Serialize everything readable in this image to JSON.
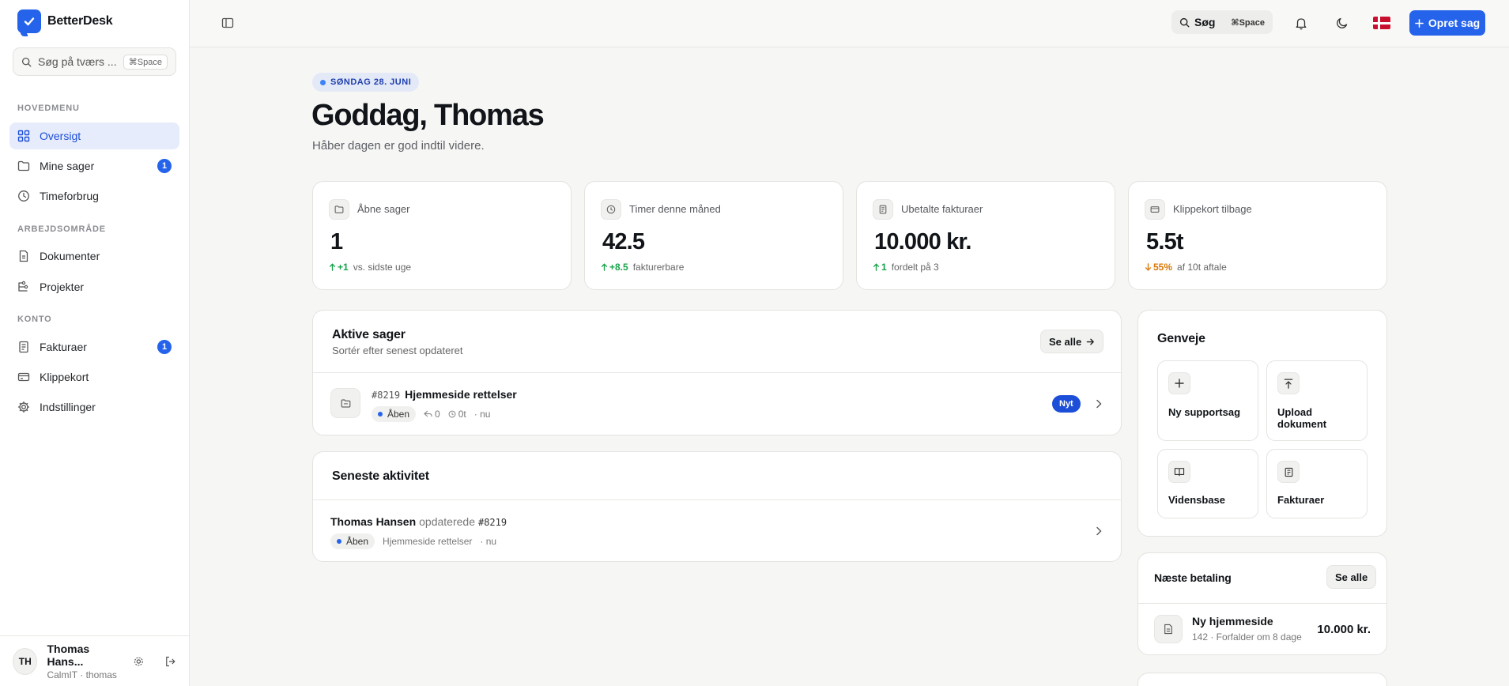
{
  "brand": {
    "name": "BetterDesk",
    "accent": "#2563eb"
  },
  "sidebar": {
    "search": {
      "placeholder": "Søg på tværs ...",
      "shortcut": "⌘Space"
    },
    "sections": {
      "main": "HOVEDMENU",
      "workspace": "ARBEJDSOMRÅDE",
      "account": "KONTO"
    },
    "items": [
      {
        "label": "Oversigt",
        "icon": "grid-icon",
        "active": true
      },
      {
        "label": "Mine sager",
        "icon": "folder-icon",
        "badge": "1"
      },
      {
        "label": "Timeforbrug",
        "icon": "clock-icon"
      },
      {
        "label": "Dokumenter",
        "icon": "document-icon"
      },
      {
        "label": "Projekter",
        "icon": "projects-icon"
      },
      {
        "label": "Fakturaer",
        "icon": "invoice-icon",
        "badge": "1"
      },
      {
        "label": "Klippekort",
        "icon": "card-icon"
      },
      {
        "label": "Indstillinger",
        "icon": "gear-icon"
      }
    ],
    "user": {
      "initials": "TH",
      "name": "Thomas Hans...",
      "sub": "CalmIT · thomas"
    }
  },
  "topbar": {
    "search_label": "Søg",
    "search_shortcut": "⌘Space",
    "create_label": "Opret sag"
  },
  "header": {
    "date": "SØNDAG 28. JUNI",
    "greeting": "Goddag, Thomas",
    "subtitle": "Håber dagen er god indtil videre."
  },
  "stats": [
    {
      "title": "Åbne sager",
      "value": "1",
      "delta": "+1",
      "direction": "up",
      "note": "vs. sidste uge",
      "icon": "folder-icon"
    },
    {
      "title": "Timer denne måned",
      "value": "42.5",
      "delta": "+8.5",
      "direction": "up",
      "note": "fakturerbare",
      "icon": "clock-icon"
    },
    {
      "title": "Ubetalte fakturaer",
      "value": "10.000 kr.",
      "delta": "1",
      "direction": "up",
      "note": "fordelt på 3",
      "icon": "invoice-icon"
    },
    {
      "title": "Klippekort tilbage",
      "value": "5.5t",
      "delta": "55%",
      "direction": "down",
      "note": "af 10t aftale",
      "icon": "card-icon"
    }
  ],
  "active_cases": {
    "title": "Aktive sager",
    "subtitle": "Sortér efter senest opdateret",
    "see_all": "Se alle",
    "rows": [
      {
        "id": "#8219",
        "title": "Hjemmeside rettelser",
        "status": "Åben",
        "replies": "0",
        "time": "0t",
        "updated": "· nu",
        "badge": "Nyt"
      }
    ]
  },
  "activity": {
    "title": "Seneste aktivitet",
    "rows": [
      {
        "actor": "Thomas Hansen",
        "action": "opdaterede",
        "ref": "#8219",
        "status": "Åben",
        "case": "Hjemmeside rettelser",
        "time": "· nu"
      }
    ]
  },
  "shortcuts": {
    "title": "Genveje",
    "items": [
      {
        "label": "Ny supportsag",
        "icon": "plus-icon"
      },
      {
        "label": "Upload dokument",
        "icon": "upload-icon"
      },
      {
        "label": "Vidensbase",
        "icon": "book-icon"
      },
      {
        "label": "Fakturaer",
        "icon": "invoice-icon"
      }
    ]
  },
  "next_payment": {
    "title": "Næste betaling",
    "see_all": "Se alle",
    "item": {
      "name": "Ny hjemmeside",
      "meta": "142 · Forfalder om 8 dage",
      "amount": "10.000 kr."
    }
  }
}
